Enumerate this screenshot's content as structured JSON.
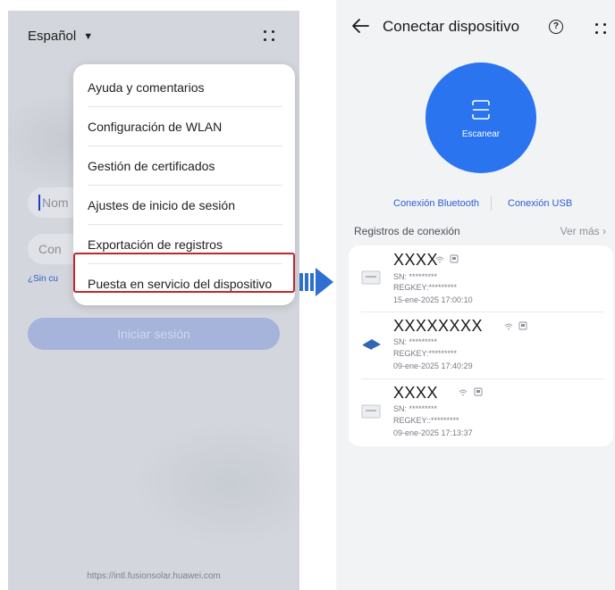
{
  "left_screen": {
    "language": "Español",
    "username_placeholder": "Nom",
    "password_placeholder": "Con",
    "forgot_link": "¿Sin cu",
    "login_button": "Iniciar sesión",
    "footer_url": "https://intl.fusionsolar.huawei.com",
    "menu": {
      "items": [
        {
          "label": "Ayuda y comentarios"
        },
        {
          "label": "Configuración de WLAN"
        },
        {
          "label": "Gestión de certificados"
        },
        {
          "label": "Ajustes de inicio de sesión"
        },
        {
          "label": "Exportación de registros"
        },
        {
          "label": "Puesta en servicio del dispositivo"
        }
      ],
      "highlighted_item": "Puesta en servicio del dispositivo",
      "highlight_color": "#c1272d"
    }
  },
  "arrow": {
    "color": "#2e6fd0"
  },
  "right_screen": {
    "title": "Conectar dispositivo",
    "scan_label": "Escanear",
    "bluetooth_link": "Conexión Bluetooth",
    "usb_link": "Conexión USB",
    "records_title": "Registros de conexión",
    "see_more": "Ver más",
    "accent_color": "#2b74f0",
    "devices": [
      {
        "name": "XXXX",
        "sn": "SN: *********",
        "regkey": "REGKEY:*********",
        "date": "15-ene-2025 17:00:10",
        "icon": "inverter-icon"
      },
      {
        "name": "XXXXXXXX",
        "sn": "SN: *********",
        "regkey": "REGKEY:*********",
        "date": "09-ene-2025 17:40:29",
        "icon": "solar-panel-icon"
      },
      {
        "name": "XXXX",
        "sn": "SN: *********",
        "regkey": "REGKEY::*********",
        "date": "09-ene-2025 17:13:37",
        "icon": "inverter-icon"
      }
    ]
  }
}
